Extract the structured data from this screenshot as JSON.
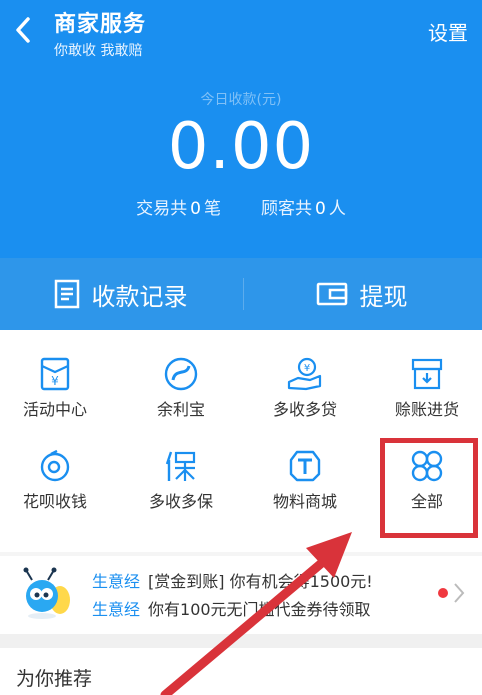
{
  "header": {
    "title": "商家服务",
    "subtitle": "你敢收 我敢赔",
    "settings_label": "设置",
    "today_label": "今日收款(元)",
    "amount": "0.00",
    "stats": {
      "tx_prefix": "交易共",
      "tx_count": "0",
      "tx_unit": "笔",
      "cust_prefix": "顾客共",
      "cust_count": "0",
      "cust_unit": "人"
    }
  },
  "actions": {
    "records_label": "收款记录",
    "withdraw_label": "提现"
  },
  "grid": {
    "items": [
      {
        "label": "活动中心",
        "icon": "envelope-yen-icon"
      },
      {
        "label": "余利宝",
        "icon": "yulibao-icon"
      },
      {
        "label": "多收多贷",
        "icon": "hand-coin-icon"
      },
      {
        "label": "赊账进货",
        "icon": "box-icon"
      },
      {
        "label": "花呗收钱",
        "icon": "huabei-icon"
      },
      {
        "label": "多收多保",
        "icon": "bao-icon"
      },
      {
        "label": "物料商城",
        "icon": "t-shield-icon"
      },
      {
        "label": "全部",
        "icon": "four-petal-icon"
      }
    ]
  },
  "banner": {
    "line1_keyword": "生意经",
    "line1_text": "[赏金到账] 你有机会得1500元!",
    "line2_keyword": "生意经",
    "line2_text": "你有100元无门槛代金券待领取"
  },
  "recommend": {
    "title": "为你推荐"
  },
  "colors": {
    "primary": "#1a8ff0",
    "action_bar": "#2e96ea",
    "highlight": "#d9333a",
    "dot": "#f0383f"
  }
}
